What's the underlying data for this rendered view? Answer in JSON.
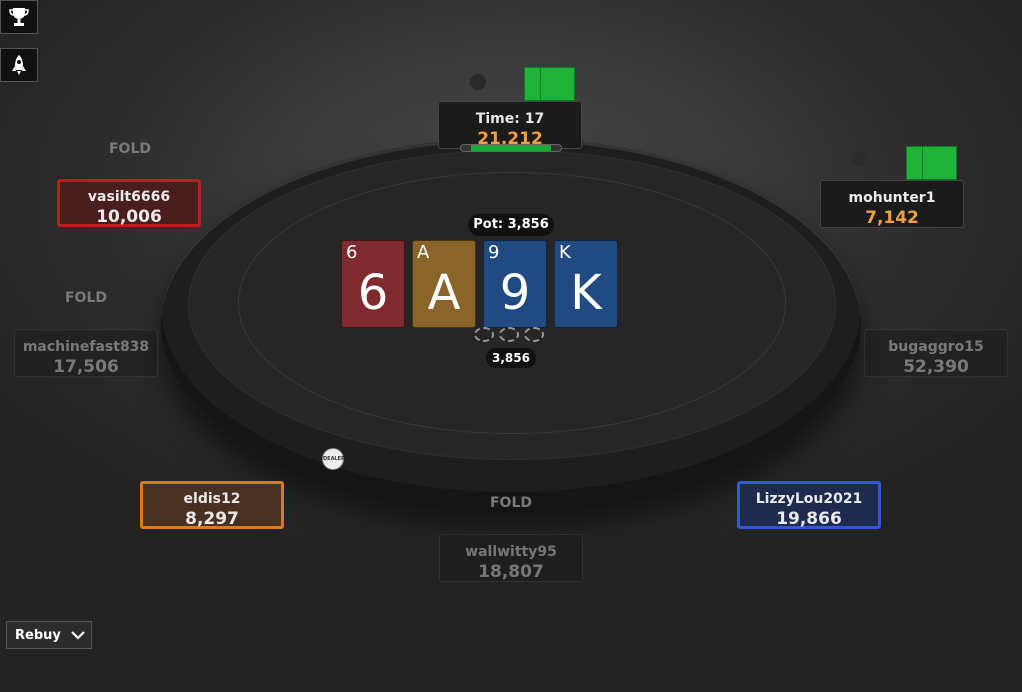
{
  "side_buttons": [
    {
      "icon": "trophy-icon"
    },
    {
      "icon": "rocket-icon"
    }
  ],
  "pot": {
    "label": "Pot: 3,856",
    "amount": "3,856"
  },
  "board": [
    {
      "rank": "6",
      "color": "red"
    },
    {
      "rank": "A",
      "color": "gold"
    },
    {
      "rank": "9",
      "color": "blue"
    },
    {
      "rank": "K",
      "color": "blue"
    }
  ],
  "active_player": {
    "time": "Time: 17",
    "stack": "21,212",
    "timer_fraction": 0.8
  },
  "seats": {
    "vasilt": {
      "name": "vasilt6666",
      "stack": "10,006",
      "status": "FOLD"
    },
    "mohunter": {
      "name": "mohunter1",
      "stack": "7,142"
    },
    "machinefast": {
      "name": "machinefast838",
      "stack": "17,506",
      "status": "FOLD"
    },
    "bugaggro": {
      "name": "bugaggro15",
      "stack": "52,390"
    },
    "eldis": {
      "name": "eldis12",
      "stack": "8,297"
    },
    "lizzy": {
      "name": "LizzyLou2021",
      "stack": "19,866"
    },
    "wallwitty": {
      "name": "wallwitty95",
      "stack": "18,807",
      "status": "FOLD"
    }
  },
  "dealer_label": "DEALER",
  "rebuy": {
    "label": "Rebuy"
  },
  "colors": {
    "card_back": "#1fb33c",
    "card_red": "#7e2a2e",
    "card_gold": "#8a6428",
    "card_blue": "#214a82",
    "highlight_red": "#c11b1b",
    "highlight_orange": "#e07818",
    "highlight_blue": "#3558d6",
    "stack_orange": "#f0a040",
    "timer_green": "#1ea83a"
  }
}
